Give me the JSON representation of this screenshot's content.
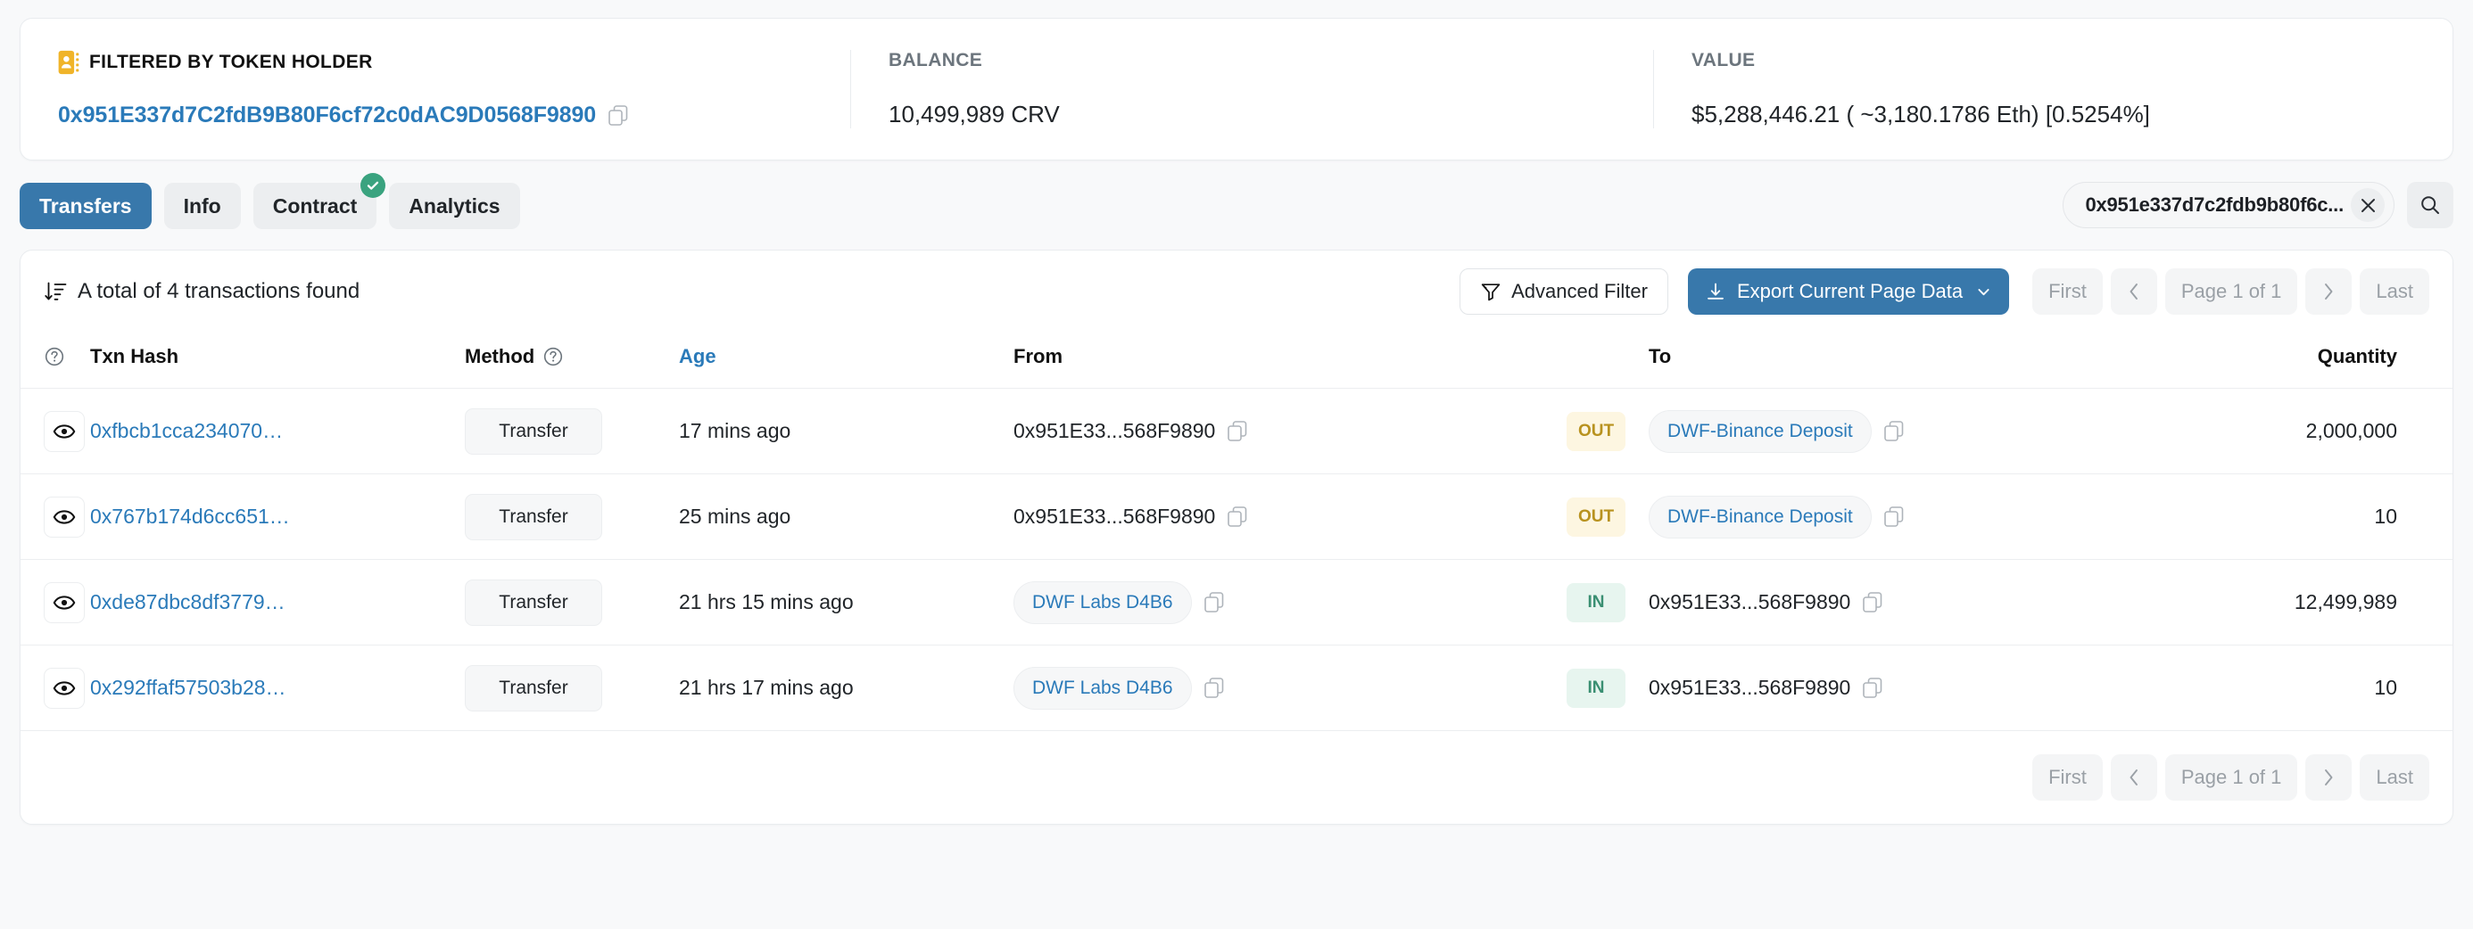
{
  "summary": {
    "filter": {
      "label": "FILTERED BY TOKEN HOLDER",
      "icon": "address-book-icon",
      "address": "0x951E337d7C2fdB9B80F6cf72c0dAC9D0568F9890",
      "copy_icon": "copy-icon",
      "accent": "#f0b429"
    },
    "balance": {
      "label": "BALANCE",
      "value": "10,499,989 CRV"
    },
    "value": {
      "label": "VALUE",
      "value": "$5,288,446.21 ( ~3,180.1786 Eth) [0.5254%]"
    }
  },
  "tabs": [
    {
      "label": "Transfers",
      "active": true,
      "verified": false
    },
    {
      "label": "Info",
      "active": false,
      "verified": false
    },
    {
      "label": "Contract",
      "active": false,
      "verified": true
    },
    {
      "label": "Analytics",
      "active": false,
      "verified": false
    }
  ],
  "search": {
    "value": "0x951e337d7c2fdb9b80f6c...",
    "clear_icon": "close-icon",
    "search_icon": "search-icon"
  },
  "toolbar": {
    "total_text": "A total of 4 transactions found",
    "sort_icon": "sort-descending-icon",
    "advanced_filter_label": "Advanced Filter",
    "filter_icon": "funnel-icon",
    "export_label": "Export Current Page Data",
    "download_icon": "download-icon",
    "caret_icon": "chevron-down-icon"
  },
  "pagination": {
    "first": "First",
    "prev_icon": "chevron-left-icon",
    "page_label": "Page 1 of 1",
    "next_icon": "chevron-right-icon",
    "last": "Last"
  },
  "table": {
    "headers": {
      "info_icon": "question-circle-icon",
      "txn_hash": "Txn Hash",
      "method": "Method",
      "method_icon": "question-circle-icon",
      "age": "Age",
      "from": "From",
      "to": "To",
      "quantity": "Quantity"
    },
    "rows": [
      {
        "eye_icon": "eye-icon",
        "txn_hash": "0xfbcb1cca234070…",
        "method": "Transfer",
        "age": "17 mins ago",
        "from": {
          "text": "0x951E33...568F9890",
          "is_chip": false,
          "copy_icon": "copy-icon"
        },
        "direction": "OUT",
        "to": {
          "text": "DWF-Binance Deposit",
          "is_chip": true,
          "copy_icon": "copy-icon"
        },
        "quantity": "2,000,000"
      },
      {
        "eye_icon": "eye-icon",
        "txn_hash": "0x767b174d6cc651…",
        "method": "Transfer",
        "age": "25 mins ago",
        "from": {
          "text": "0x951E33...568F9890",
          "is_chip": false,
          "copy_icon": "copy-icon"
        },
        "direction": "OUT",
        "to": {
          "text": "DWF-Binance Deposit",
          "is_chip": true,
          "copy_icon": "copy-icon"
        },
        "quantity": "10"
      },
      {
        "eye_icon": "eye-icon",
        "txn_hash": "0xde87dbc8df3779…",
        "method": "Transfer",
        "age": "21 hrs 15 mins ago",
        "from": {
          "text": "DWF Labs D4B6",
          "is_chip": true,
          "copy_icon": "copy-icon"
        },
        "direction": "IN",
        "to": {
          "text": "0x951E33...568F9890",
          "is_chip": false,
          "copy_icon": "copy-icon"
        },
        "quantity": "12,499,989"
      },
      {
        "eye_icon": "eye-icon",
        "txn_hash": "0x292ffaf57503b28…",
        "method": "Transfer",
        "age": "21 hrs 17 mins ago",
        "from": {
          "text": "DWF Labs D4B6",
          "is_chip": true,
          "copy_icon": "copy-icon"
        },
        "direction": "IN",
        "to": {
          "text": "0x951E33...568F9890",
          "is_chip": false,
          "copy_icon": "copy-icon"
        },
        "quantity": "10"
      }
    ]
  }
}
